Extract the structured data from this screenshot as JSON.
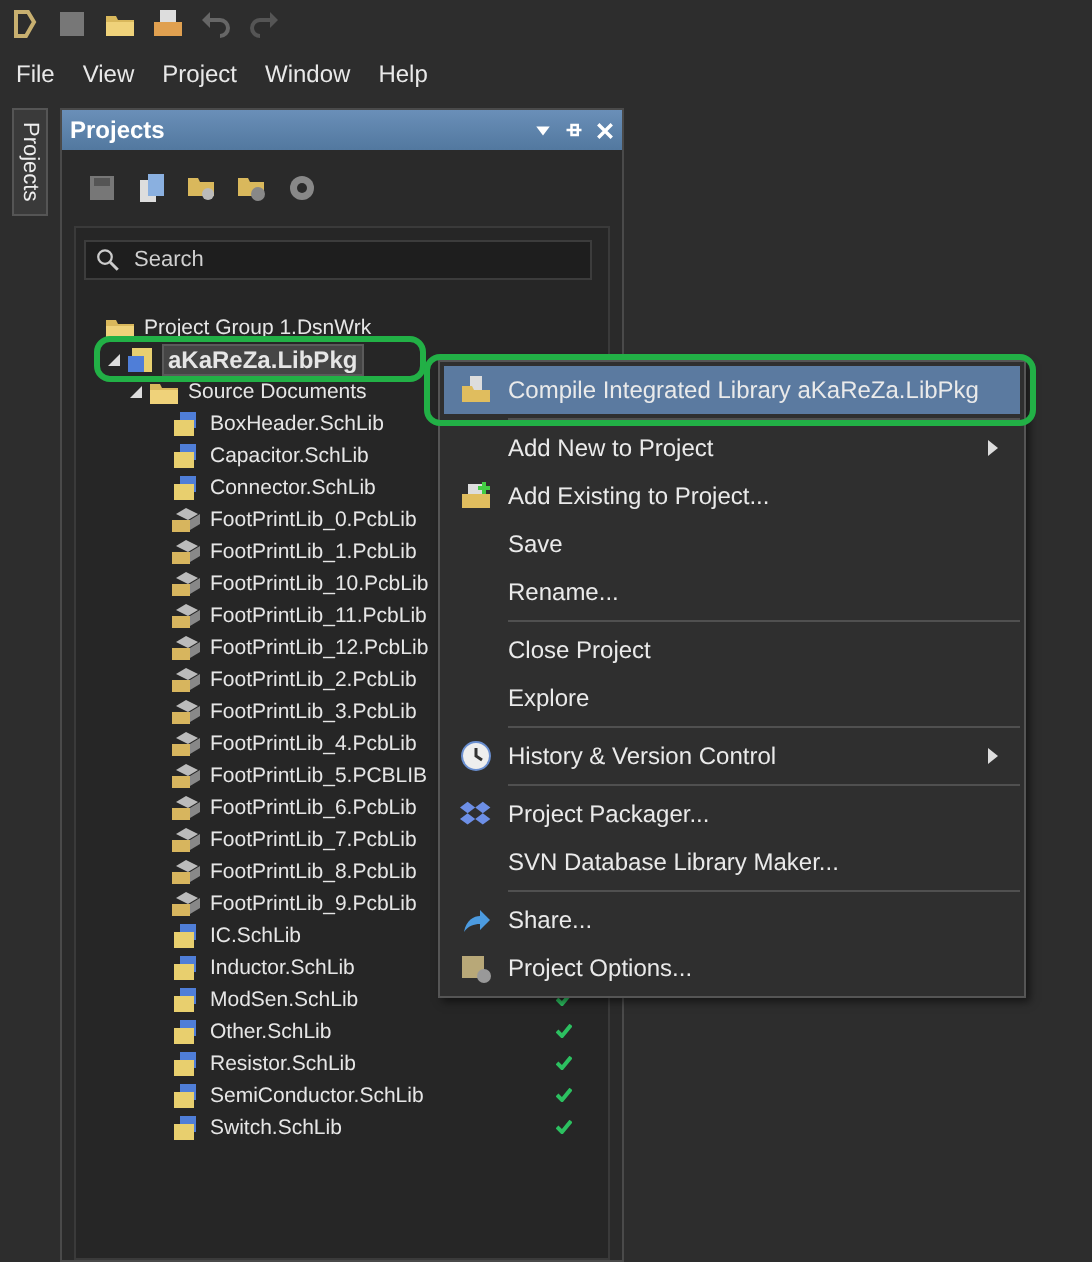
{
  "menu_bar": [
    "File",
    "View",
    "Project",
    "Window",
    "Help"
  ],
  "side_tab": "Projects",
  "panel": {
    "title": "Projects",
    "search": {
      "placeholder": "Search"
    },
    "tree": [
      {
        "label": "Project Group 1.DsnWrk",
        "kind": "group",
        "children": [
          {
            "label": "aKaReZa.LibPkg",
            "kind": "project",
            "expanded": true,
            "selected": true,
            "annotated": true,
            "children": [
              {
                "label": "Source Documents",
                "kind": "folder",
                "expanded": true,
                "children": [
                  {
                    "label": "BoxHeader.SchLib",
                    "kind": "sch",
                    "checked": false
                  },
                  {
                    "label": "Capacitor.SchLib",
                    "kind": "sch",
                    "checked": false
                  },
                  {
                    "label": "Connector.SchLib",
                    "kind": "sch",
                    "checked": false
                  },
                  {
                    "label": "FootPrintLib_0.PcbLib",
                    "kind": "pcb",
                    "checked": false
                  },
                  {
                    "label": "FootPrintLib_1.PcbLib",
                    "kind": "pcb",
                    "checked": false
                  },
                  {
                    "label": "FootPrintLib_10.PcbLib",
                    "kind": "pcb",
                    "checked": false
                  },
                  {
                    "label": "FootPrintLib_11.PcbLib",
                    "kind": "pcb",
                    "checked": false
                  },
                  {
                    "label": "FootPrintLib_12.PcbLib",
                    "kind": "pcb",
                    "checked": false
                  },
                  {
                    "label": "FootPrintLib_2.PcbLib",
                    "kind": "pcb",
                    "checked": false
                  },
                  {
                    "label": "FootPrintLib_3.PcbLib",
                    "kind": "pcb",
                    "checked": false
                  },
                  {
                    "label": "FootPrintLib_4.PcbLib",
                    "kind": "pcb",
                    "checked": false
                  },
                  {
                    "label": "FootPrintLib_5.PCBLIB",
                    "kind": "pcb",
                    "checked": false
                  },
                  {
                    "label": "FootPrintLib_6.PcbLib",
                    "kind": "pcb",
                    "checked": false
                  },
                  {
                    "label": "FootPrintLib_7.PcbLib",
                    "kind": "pcb",
                    "checked": false
                  },
                  {
                    "label": "FootPrintLib_8.PcbLib",
                    "kind": "pcb",
                    "checked": false
                  },
                  {
                    "label": "FootPrintLib_9.PcbLib",
                    "kind": "pcb",
                    "checked": false
                  },
                  {
                    "label": "IC.SchLib",
                    "kind": "sch",
                    "checked": false
                  },
                  {
                    "label": "Inductor.SchLib",
                    "kind": "sch",
                    "checked": false
                  },
                  {
                    "label": "ModSen.SchLib",
                    "kind": "sch",
                    "checked": true
                  },
                  {
                    "label": "Other.SchLib",
                    "kind": "sch",
                    "checked": true
                  },
                  {
                    "label": "Resistor.SchLib",
                    "kind": "sch",
                    "checked": true
                  },
                  {
                    "label": "SemiConductor.SchLib",
                    "kind": "sch",
                    "checked": true
                  },
                  {
                    "label": "Switch.SchLib",
                    "kind": "sch",
                    "checked": true
                  }
                ]
              }
            ]
          }
        ]
      }
    ]
  },
  "context_menu": [
    [
      {
        "label": "Compile Integrated Library aKaReZa.LibPkg",
        "kind": "compile",
        "submenu": false,
        "selected": true,
        "annotated": true
      }
    ],
    [
      {
        "label": "Add New to Project",
        "kind": "plain",
        "submenu": true,
        "selected": false,
        "annotated": false
      },
      {
        "label": "Add Existing to Project...",
        "kind": "add",
        "submenu": false,
        "selected": false,
        "annotated": false
      },
      {
        "label": "Save",
        "kind": "plain",
        "submenu": false,
        "selected": false,
        "annotated": false
      },
      {
        "label": "Rename...",
        "kind": "plain",
        "submenu": false,
        "selected": false,
        "annotated": false
      }
    ],
    [
      {
        "label": "Close Project",
        "kind": "plain",
        "submenu": false,
        "selected": false,
        "annotated": false
      },
      {
        "label": "Explore",
        "kind": "plain",
        "submenu": false,
        "selected": false,
        "annotated": false
      }
    ],
    [
      {
        "label": "History & Version Control",
        "kind": "history",
        "submenu": true,
        "selected": false,
        "annotated": false
      }
    ],
    [
      {
        "label": "Project Packager...",
        "kind": "packager",
        "submenu": false,
        "selected": false,
        "annotated": false
      },
      {
        "label": "SVN Database Library Maker...",
        "kind": "plain",
        "submenu": false,
        "selected": false,
        "annotated": false
      }
    ],
    [
      {
        "label": "Share...",
        "kind": "share",
        "submenu": false,
        "selected": false,
        "annotated": false
      },
      {
        "label": "Project Options...",
        "kind": "options",
        "submenu": false,
        "selected": false,
        "annotated": false
      }
    ]
  ]
}
